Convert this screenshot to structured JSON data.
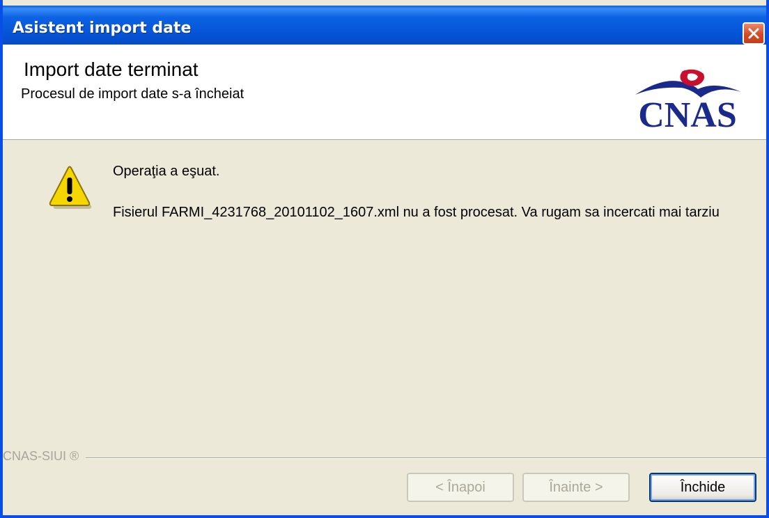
{
  "window": {
    "title": "Asistent import date",
    "close_icon": "close-icon"
  },
  "header": {
    "title": "Import date terminat",
    "subtitle": "Procesul de import date s-a încheiat",
    "logo_text": "CNAS"
  },
  "content": {
    "icon": "warning-icon",
    "status": "Operaţia a eşuat.",
    "message": "Fisierul FARMI_4231768_20101102_1607.xml nu a fost procesat. Va rugam sa incercati mai tarziu"
  },
  "footer": {
    "brand": "CNAS-SIUI ®",
    "back_label": "< Înapoi",
    "next_label": "Înainte >",
    "close_label": "Închide"
  },
  "colors": {
    "titlebar": "#0554d9",
    "logo_blue": "#1a2a8c",
    "logo_red": "#c8102e",
    "dialog_bg": "#ece9d8"
  }
}
